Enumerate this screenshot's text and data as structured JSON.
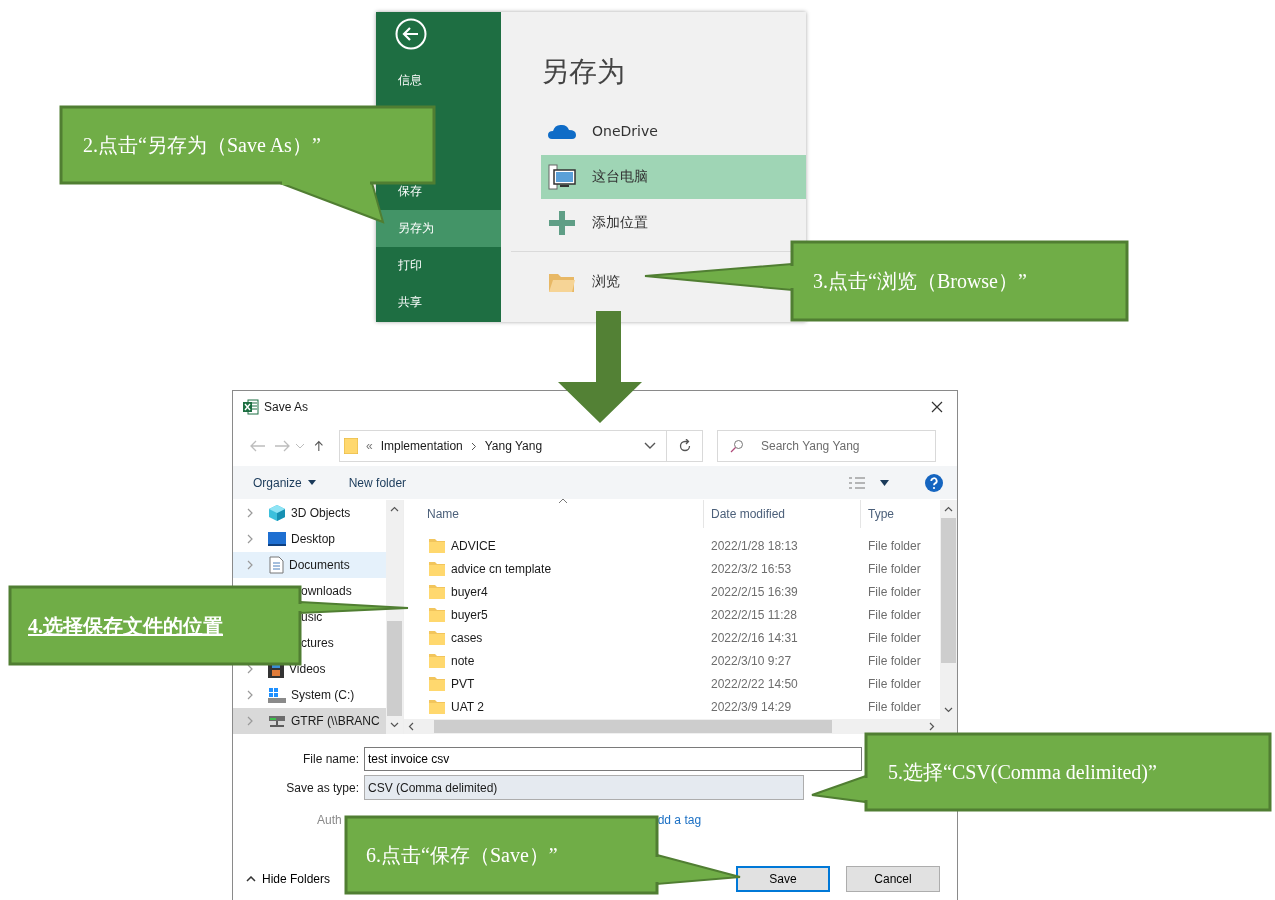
{
  "backstage": {
    "sidebar": [
      {
        "label": "信息",
        "selected": false
      },
      {
        "label": "保存",
        "selected": false
      },
      {
        "label": "另存为",
        "selected": true
      },
      {
        "label": "打印",
        "selected": false
      },
      {
        "label": "共享",
        "selected": false
      }
    ],
    "title": "另存为",
    "locations": [
      {
        "kind": "onedrive",
        "label": "OneDrive",
        "selected": false
      },
      {
        "kind": "computer",
        "label": "这台电脑",
        "selected": true
      },
      {
        "kind": "add",
        "label": "添加位置",
        "selected": false
      },
      {
        "kind": "browse",
        "label": "浏览",
        "selected": false
      }
    ]
  },
  "dialog": {
    "title": "Save As",
    "address": {
      "overflow": "«",
      "path": [
        "Implementation",
        "Yang Yang"
      ]
    },
    "search": {
      "placeholder": "Search Yang Yang"
    },
    "toolbar": {
      "organize": "Organize",
      "new_folder": "New folder"
    },
    "tree": [
      {
        "label": "3D Objects",
        "kind": "cube",
        "selected": false,
        "hovered": false
      },
      {
        "label": "Desktop",
        "kind": "desktop",
        "selected": false,
        "hovered": false
      },
      {
        "label": "Documents",
        "kind": "document",
        "selected": true,
        "hovered": false
      },
      {
        "label": "ownloads",
        "kind": "partial",
        "selected": false,
        "hovered": false
      },
      {
        "label": "usic",
        "kind": "partial",
        "selected": false,
        "hovered": false
      },
      {
        "label": "ctures",
        "kind": "partial",
        "selected": false,
        "hovered": false
      },
      {
        "label": "Videos",
        "kind": "video",
        "selected": false,
        "hovered": false
      },
      {
        "label": "System (C:)",
        "kind": "drive",
        "selected": false,
        "hovered": false
      },
      {
        "label": "GTRF (\\\\BRANC",
        "kind": "network",
        "selected": false,
        "hovered": true
      }
    ],
    "columns": [
      "Name",
      "Date modified",
      "Type"
    ],
    "rows": [
      {
        "name": "ADVICE",
        "date": "2022/1/28 18:13",
        "type": "File folder"
      },
      {
        "name": "advice cn template",
        "date": "2022/3/2 16:53",
        "type": "File folder"
      },
      {
        "name": "buyer4",
        "date": "2022/2/15 16:39",
        "type": "File folder"
      },
      {
        "name": "buyer5",
        "date": "2022/2/15 11:28",
        "type": "File folder"
      },
      {
        "name": "cases",
        "date": "2022/2/16 14:31",
        "type": "File folder"
      },
      {
        "name": "note",
        "date": "2022/3/10 9:27",
        "type": "File folder"
      },
      {
        "name": "PVT",
        "date": "2022/2/22 14:50",
        "type": "File folder"
      },
      {
        "name": "UAT 2",
        "date": "2022/3/9 14:29",
        "type": "File folder"
      }
    ],
    "file_name": {
      "label": "File name:",
      "value": "test invoice csv"
    },
    "save_type": {
      "label": "Save as type:",
      "value": "CSV (Comma delimited)"
    },
    "authors_label": "Auth",
    "tag_link": "dd a tag",
    "hide_folders": "Hide Folders",
    "buttons": [
      {
        "label": "Save",
        "kind": "primary"
      },
      {
        "label": "Cancel",
        "kind": "secondary"
      }
    ]
  },
  "callouts": [
    {
      "text": "2.点击“另存为（Save As）”",
      "kind": "plain"
    },
    {
      "text": "3.点击“浏览（Browse）”",
      "kind": "plain"
    },
    {
      "text": "4.选择保存文件的位置",
      "kind": "bold"
    },
    {
      "text": "5.选择“CSV(Comma delimited)”",
      "kind": "plain"
    },
    {
      "text": "6.点击“保存（Save）”",
      "kind": "plain"
    }
  ]
}
